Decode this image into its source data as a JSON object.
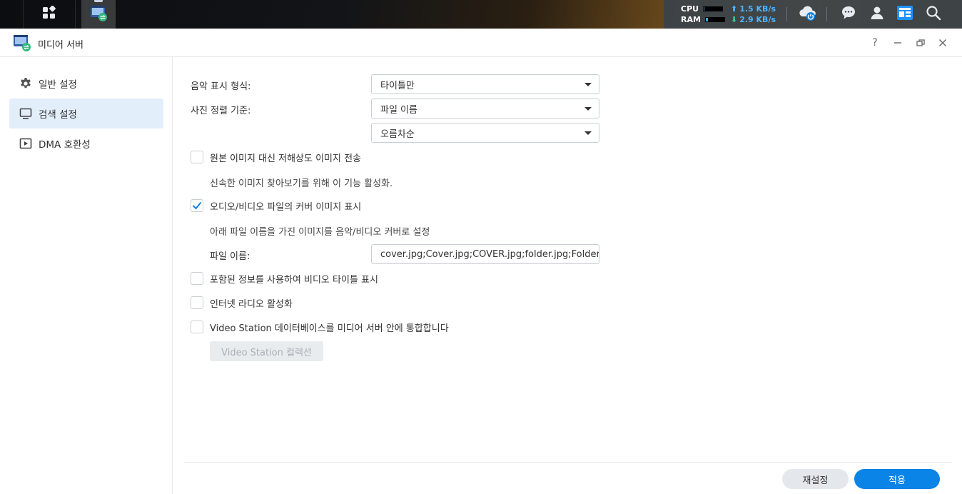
{
  "taskbar": {
    "main_menu_icon": "grid-icon",
    "active_app_icon": "media-server-icon",
    "cpu_label": "CPU",
    "ram_label": "RAM",
    "cpu_usage_fraction": 0.03,
    "ram_usage_fraction": 0.1,
    "upload_speed": "1.5 KB/s",
    "download_speed": "2.9 KB/s",
    "icons": [
      "cloud-sync-icon",
      "chat-icon",
      "user-icon",
      "widgets-icon",
      "search-icon"
    ]
  },
  "window": {
    "title": "미디어 서버",
    "controls": {
      "help": "?",
      "minimize": "—",
      "restore": "❐",
      "close": "✕"
    }
  },
  "sidebar": {
    "items": [
      {
        "label": "일반 설정",
        "icon": "gear-icon",
        "active": false
      },
      {
        "label": "검색 설정",
        "icon": "monitor-icon",
        "active": true
      },
      {
        "label": "DMA 호환성",
        "icon": "play-box-icon",
        "active": false
      }
    ]
  },
  "form": {
    "music_display_label": "음악 표시 형식:",
    "music_display_value": "타이틀만",
    "photo_sort_label": "사진 정렬 기준:",
    "photo_sort_value": "파일 이름",
    "photo_order_value": "오름차순",
    "low_res_label": "원본 이미지 대신 저해상도 이미지 전송",
    "low_res_checked": false,
    "low_res_hint": "신속한 이미지 찾아보기를 위해 이 기능 활성화.",
    "cover_image_label": "오디오/비디오 파일의 커버 이미지 표시",
    "cover_image_checked": true,
    "cover_image_hint": "아래 파일 이름을 가진 이미지를 음악/비디오 커버로 설정",
    "filename_label": "파일 이름:",
    "filename_value": "cover.jpg;Cover.jpg;COVER.jpg;folder.jpg;Folder.jpg",
    "embedded_info_label": "포함된 정보를 사용하여 비디오 타이틀 표시",
    "embedded_info_checked": false,
    "internet_radio_label": "인터넷 라디오 활성화",
    "internet_radio_checked": false,
    "video_station_label": "Video Station 데이터베이스를 미디어 서버 안에 통합합니다",
    "video_station_checked": false,
    "video_station_collection_button": "Video Station 컬렉션"
  },
  "footer": {
    "reset_label": "재설정",
    "apply_label": "적용"
  },
  "colors": {
    "accent": "#0a84e6",
    "active_nav_bg": "#e3eefb",
    "upload_color": "#4fb3ff",
    "download_color": "#3cc28a"
  }
}
